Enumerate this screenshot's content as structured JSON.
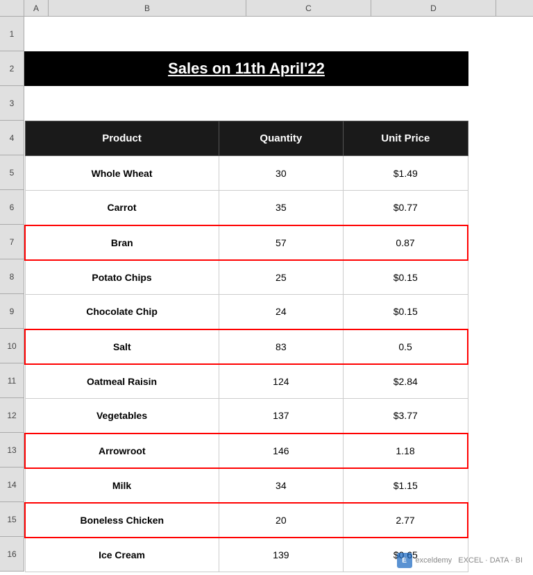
{
  "spreadsheet": {
    "title": "Sales on 11th April'22",
    "col_headers": [
      "",
      "A",
      "B",
      "C",
      "D"
    ],
    "col_header_labels": {
      "a": "A",
      "b": "B",
      "c": "C",
      "d": "D"
    },
    "table": {
      "headers": [
        "Product",
        "Quantity",
        "Unit Price"
      ],
      "rows": [
        {
          "id": "row5",
          "product": "Whole Wheat",
          "quantity": "30",
          "price": "$1.49",
          "highlighted": false
        },
        {
          "id": "row6",
          "product": "Carrot",
          "quantity": "35",
          "price": "$0.77",
          "highlighted": false
        },
        {
          "id": "row7",
          "product": "Bran",
          "quantity": "57",
          "price": "0.87",
          "highlighted": true
        },
        {
          "id": "row8",
          "product": "Potato Chips",
          "quantity": "25",
          "price": "$0.15",
          "highlighted": false
        },
        {
          "id": "row9",
          "product": "Chocolate Chip",
          "quantity": "24",
          "price": "$0.15",
          "highlighted": false
        },
        {
          "id": "row10",
          "product": "Salt",
          "quantity": "83",
          "price": "0.5",
          "highlighted": true
        },
        {
          "id": "row11",
          "product": "Oatmeal Raisin",
          "quantity": "124",
          "price": "$2.84",
          "highlighted": false
        },
        {
          "id": "row12",
          "product": "Vegetables",
          "quantity": "137",
          "price": "$3.77",
          "highlighted": false
        },
        {
          "id": "row13",
          "product": "Arrowroot",
          "quantity": "146",
          "price": "1.18",
          "highlighted": true
        },
        {
          "id": "row14",
          "product": "Milk",
          "quantity": "34",
          "price": "$1.15",
          "highlighted": false
        },
        {
          "id": "row15",
          "product": "Boneless Chicken",
          "quantity": "20",
          "price": "2.77",
          "highlighted": true
        },
        {
          "id": "row16",
          "product": "Ice Cream",
          "quantity": "139",
          "price": "$0.65",
          "highlighted": false
        }
      ]
    },
    "watermark": {
      "text": "exceldemy   EXCEL · DATA · BI",
      "icon": "E"
    }
  }
}
